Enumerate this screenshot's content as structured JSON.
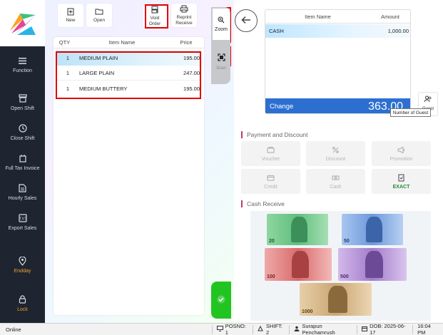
{
  "sidebar": {
    "items": [
      {
        "label": "Function",
        "icon": "hamburger-icon"
      },
      {
        "label": "Open Shift",
        "icon": "register-icon"
      },
      {
        "label": "Close Shift",
        "icon": "clock-icon"
      },
      {
        "label": "Full Tax Invoice",
        "icon": "receipt-icon"
      },
      {
        "label": "Hourly Sales",
        "icon": "document-icon"
      },
      {
        "label": "Export Sales",
        "icon": "export-icon"
      },
      {
        "label": "Endday",
        "icon": "location-pin-icon"
      },
      {
        "label": "Lock",
        "icon": "lock-icon"
      }
    ]
  },
  "toolbar": {
    "new_label": "New",
    "open_label": "Open",
    "void_order_label": "Void Order",
    "reprint_label": "Reprint Receive"
  },
  "order_table": {
    "headers": {
      "qty": "QTY",
      "item": "Item Name",
      "price": "Price"
    },
    "rows": [
      {
        "qty": "1",
        "name": "MEDIUM PLAIN",
        "price": "195.00"
      },
      {
        "qty": "1",
        "name": "LARGE PLAIN",
        "price": "247.00"
      },
      {
        "qty": "1",
        "name": "MEDIUM BUTTERY",
        "price": "195.00"
      }
    ]
  },
  "side_tabs": {
    "zoom_label": "Zoom",
    "scan_label": "Scan"
  },
  "payment_table": {
    "headers": {
      "item": "Item Name",
      "amount": "Amount"
    },
    "rows": [
      {
        "name": "CASH",
        "amount": "1,000.00"
      }
    ],
    "change_label": "Change",
    "change_value": "363.00"
  },
  "guest": {
    "label": "Guest",
    "tooltip": "Number of Guest"
  },
  "payment_discount": {
    "title": "Payment and Discount",
    "buttons": [
      {
        "label": "Voucher",
        "icon": "voucher-icon"
      },
      {
        "label": "Discount",
        "icon": "percent-icon"
      },
      {
        "label": "Promotion",
        "icon": "megaphone-icon"
      },
      {
        "label": "Credit",
        "icon": "credit-card-icon"
      },
      {
        "label": "Cash",
        "icon": "cash-icon"
      },
      {
        "label": "EXACT",
        "icon": "exact-icon"
      }
    ]
  },
  "cash_receive": {
    "title": "Cash Receive",
    "notes": [
      {
        "value": "20",
        "color": "#4caf6e"
      },
      {
        "value": "50",
        "color": "#5b8fd8"
      },
      {
        "value": "100",
        "color": "#d85a5a"
      },
      {
        "value": "500",
        "color": "#9c6bc4"
      },
      {
        "value": "1000",
        "color": "#b08a5a"
      }
    ]
  },
  "statusbar": {
    "online": "Online",
    "posno": "POSNO: 1",
    "shift": "SHIFT: 2",
    "user": "Surapun Penchamrush",
    "dob": "DOB: 2025-06-17",
    "time": "16:04 PM"
  }
}
